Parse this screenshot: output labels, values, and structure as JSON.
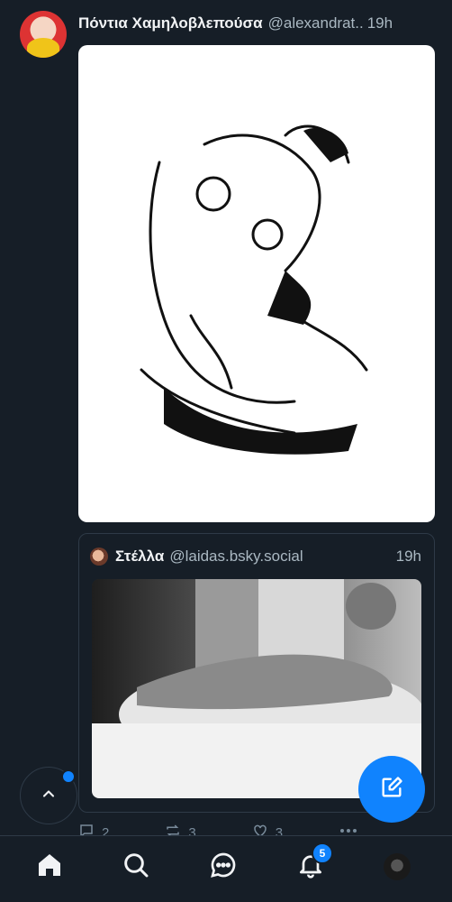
{
  "post": {
    "author_name": "Πόντια Χαμηλοβλεπούσα",
    "author_handle": "@alexandrat..",
    "time": "19h"
  },
  "quote": {
    "author_name": "Στέλλα",
    "author_handle": "@laidas.bsky.social",
    "time": "19h"
  },
  "actions": {
    "reply_count": "2",
    "repost_count": "3",
    "like_count": "3"
  },
  "nav": {
    "notifications_badge": "5"
  },
  "colors": {
    "background": "#161e27",
    "accent": "#1083fe",
    "muted": "#788a9a"
  },
  "icons": [
    "home-icon",
    "search-icon",
    "chat-icon",
    "bell-icon",
    "compose-icon",
    "chevron-up-icon",
    "reply-icon",
    "repost-icon",
    "heart-icon",
    "more-icon"
  ]
}
